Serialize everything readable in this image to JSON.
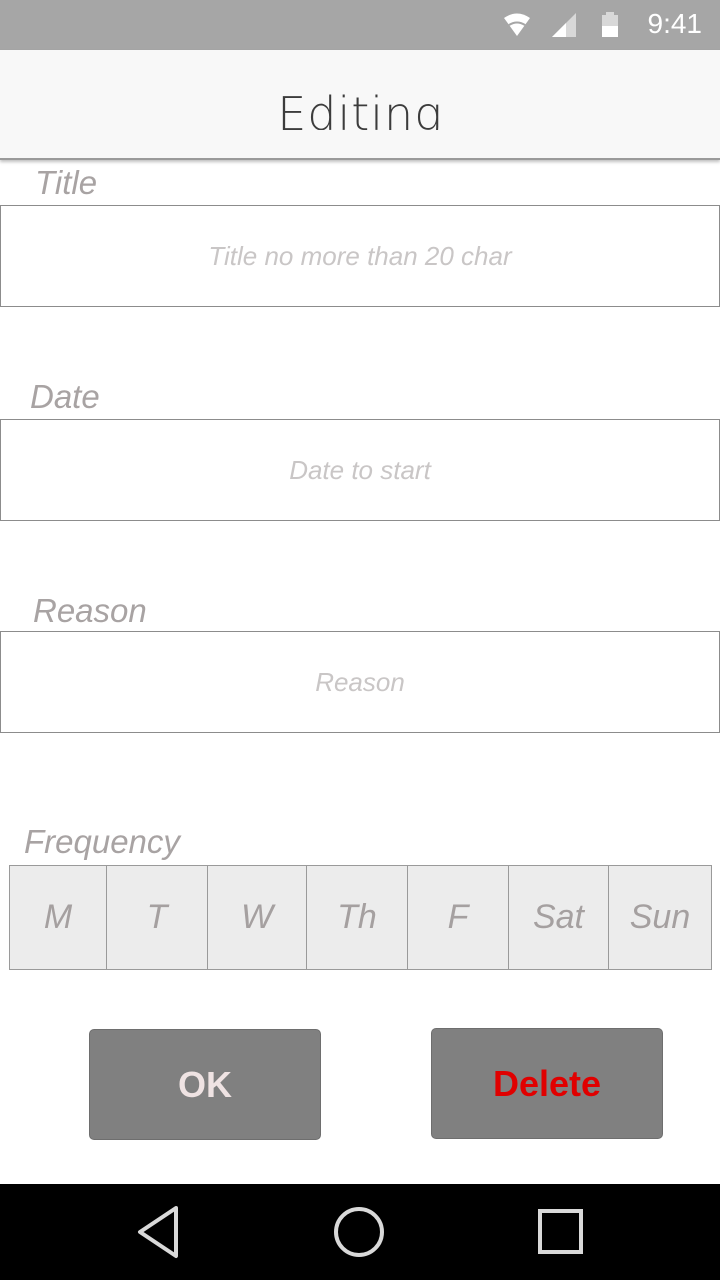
{
  "status_bar": {
    "time": "9:41",
    "icons": [
      "wifi-icon",
      "cell-signal-icon",
      "battery-icon"
    ]
  },
  "app_bar": {
    "title": "Editing"
  },
  "form": {
    "title": {
      "label": "Title",
      "placeholder": "Title no more than 20 char"
    },
    "date": {
      "label": "Date",
      "placeholder": "Date to start"
    },
    "reason": {
      "label": "Reason",
      "placeholder": "Reason"
    },
    "frequency": {
      "label": "Frequency",
      "days": [
        "M",
        "T",
        "W",
        "Th",
        "F",
        "Sat",
        "Sun"
      ]
    }
  },
  "buttons": {
    "ok_label": "OK",
    "delete_label": "Delete"
  },
  "colors": {
    "status_bar_bg": "#a6a6a6",
    "button_bg": "#808080",
    "ok_text": "#efe3e3",
    "delete_text": "#e00000",
    "label_text": "#a8a3a3"
  },
  "nav_bar": {
    "icons": [
      "back-icon",
      "home-icon",
      "recents-icon"
    ]
  }
}
